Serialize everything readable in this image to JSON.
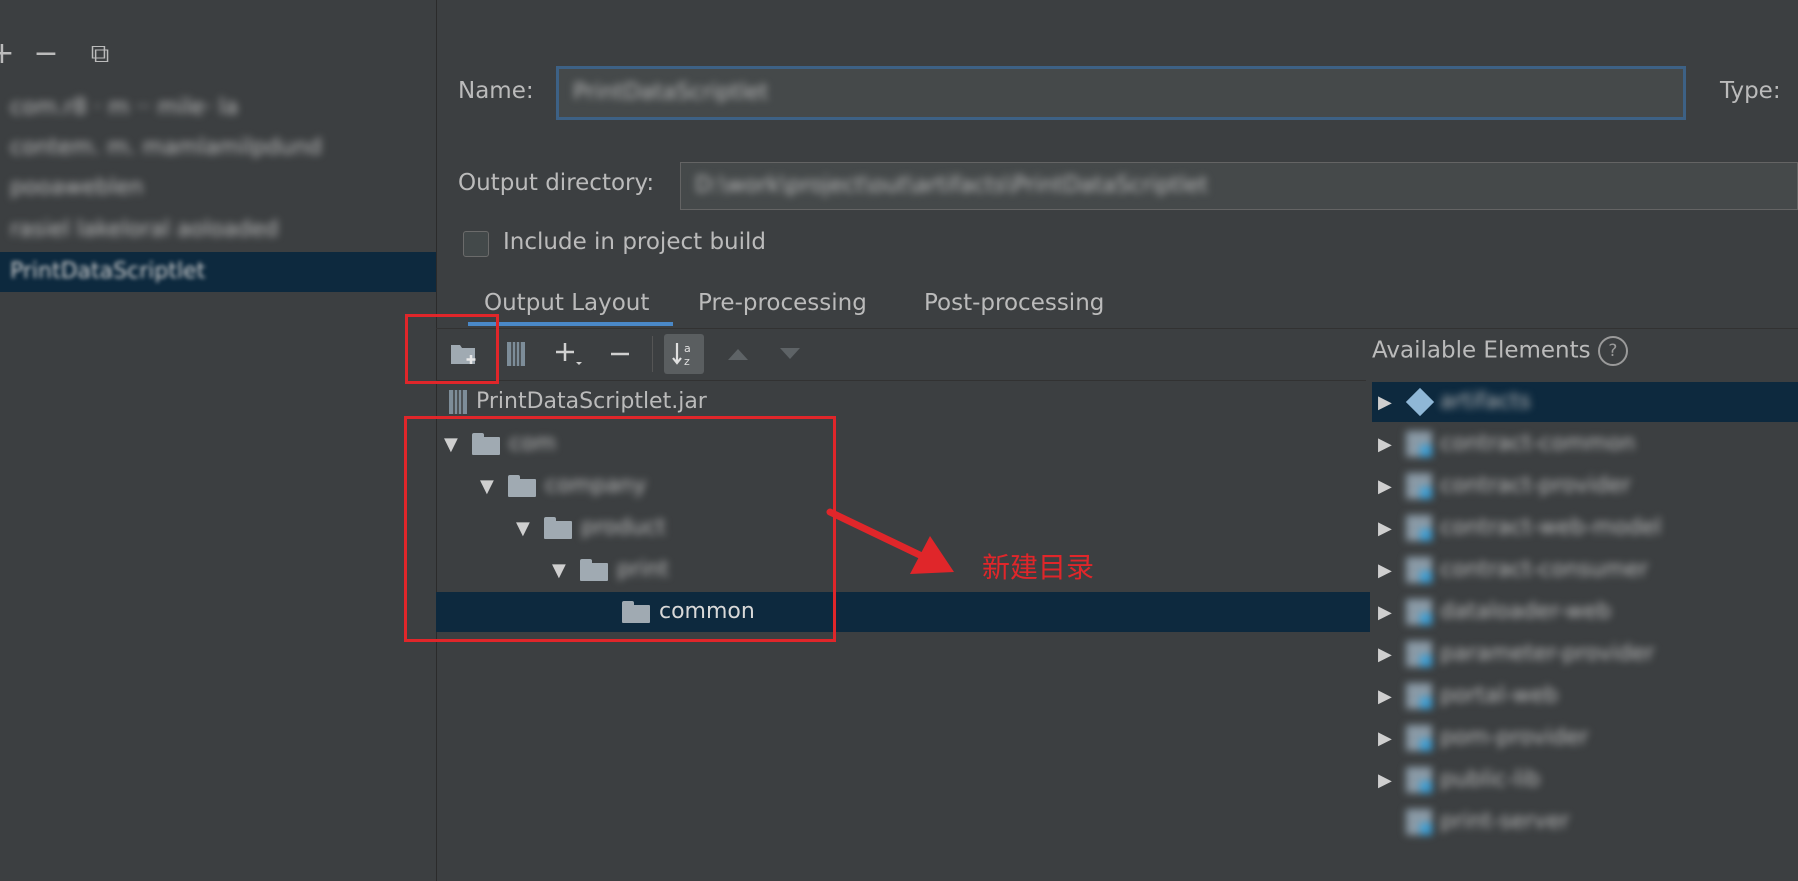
{
  "left_panel": {
    "toolbar": [
      {
        "name": "add-icon",
        "glyph": "+"
      },
      {
        "name": "remove-icon",
        "glyph": "−"
      },
      {
        "name": "copy-icon",
        "glyph": "⧉"
      }
    ],
    "items": [
      {
        "label": "com.r8 · m ·· mile· la"
      },
      {
        "label": "contem. m. mamlamilpdund"
      },
      {
        "label": "pooaweblen"
      },
      {
        "label": "rasiel lakeloral aoloaded"
      },
      {
        "label": "PrintDataScriptlet",
        "selected": true
      }
    ]
  },
  "form": {
    "name_label": "Name:",
    "name_value": "PrintDataScriptlet",
    "type_label": "Type:",
    "output_dir_label": "Output directory:",
    "output_dir_value": "D:\\work\\project\\out\\artifacts\\PrintDataScriptlet",
    "include_label": "Include in project build",
    "include_checked": false
  },
  "tabs": [
    {
      "label": "Output Layout",
      "active": true
    },
    {
      "label": "Pre-processing",
      "active": false
    },
    {
      "label": "Post-processing",
      "active": false
    }
  ],
  "toolbar_icons": [
    "new-folder-icon",
    "archive-icon",
    "add-icon",
    "remove-icon",
    "sort-icon",
    "move-up-icon",
    "move-down-icon"
  ],
  "layout_tree": {
    "jar_name": "PrintDataScriptlet.jar",
    "folders": [
      {
        "label": "com",
        "depth": 0
      },
      {
        "label": "company",
        "depth": 1
      },
      {
        "label": "product",
        "depth": 2
      },
      {
        "label": "print",
        "depth": 3
      },
      {
        "label": "common",
        "depth": 4,
        "selected": true
      }
    ]
  },
  "available": {
    "title": "Available Elements",
    "help_glyph": "?",
    "items": [
      {
        "label": "artifacts",
        "selected": true,
        "blurred": true
      },
      {
        "label": "contract-common",
        "blurred": true
      },
      {
        "label": "contract-provider",
        "blurred": true
      },
      {
        "label": "contract-web-model",
        "blurred": true
      },
      {
        "label": "contract-consumer",
        "blurred": true
      },
      {
        "label": "dataloader-web",
        "blurred": true
      },
      {
        "label": "parameter-provider",
        "blurred": true
      },
      {
        "label": "portal-web",
        "blurred": true
      },
      {
        "label": "pom-provider",
        "blurred": true
      },
      {
        "label": "public-lib",
        "blurred": true
      },
      {
        "label": "print-server",
        "blurred": true
      }
    ]
  },
  "annotation": {
    "text": "新建目录",
    "color": "#e0262a"
  }
}
